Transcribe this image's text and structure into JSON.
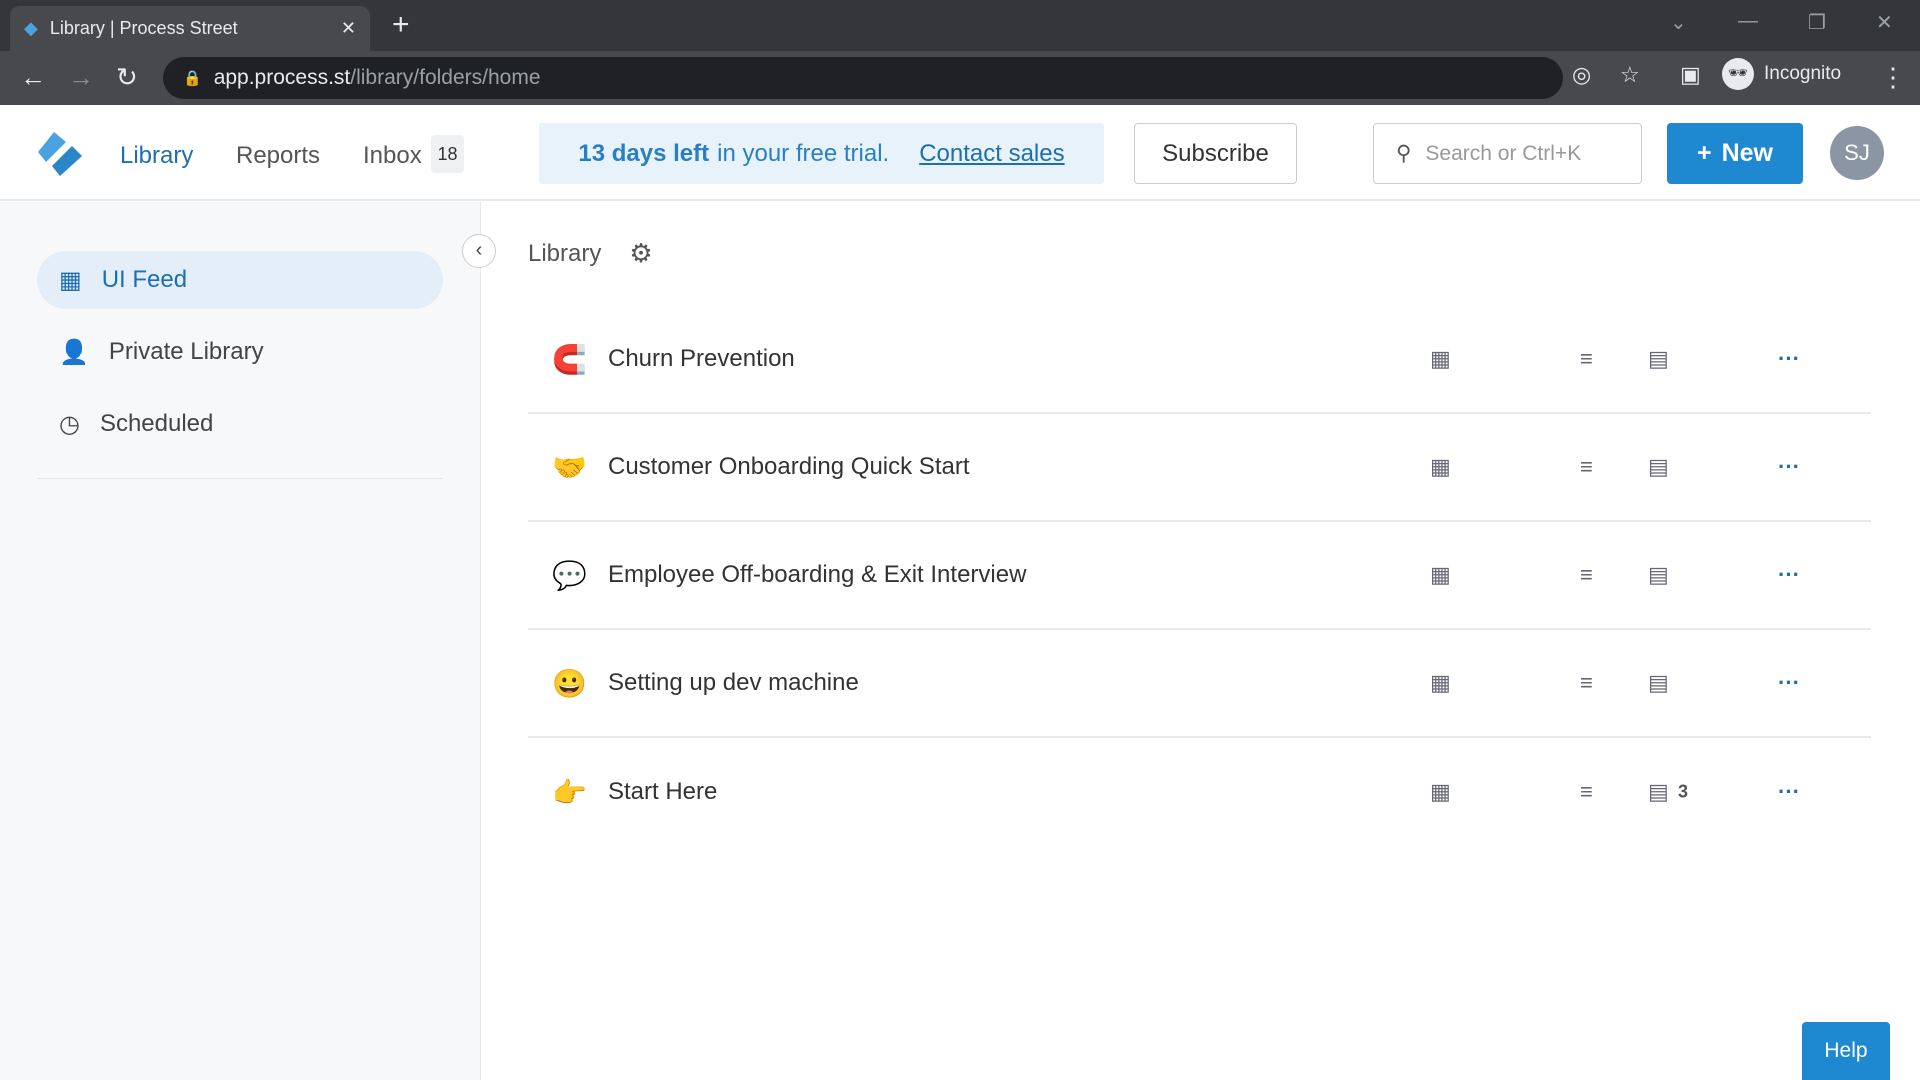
{
  "browser": {
    "tab_title": "Library | Process Street",
    "url_host": "app.process.st",
    "url_path": "/library/folders/home",
    "profile": "Incognito"
  },
  "header": {
    "nav": [
      {
        "label": "Library"
      },
      {
        "label": "Reports"
      },
      {
        "label": "Inbox"
      }
    ],
    "inbox_count": "18",
    "trial": {
      "bold": "13 days left",
      "rest": "in your free trial.",
      "link": "Contact sales"
    },
    "subscribe": "Subscribe",
    "search_placeholder": "Search or Ctrl+K",
    "new_label": "New",
    "avatar": "SJ"
  },
  "sidebar": {
    "items": [
      {
        "label": "UI Feed",
        "icon": "building-icon",
        "active": true
      },
      {
        "label": "Private Library",
        "icon": "user-lock-icon"
      },
      {
        "label": "Scheduled",
        "icon": "clock-icon"
      }
    ]
  },
  "breadcrumb": "Library",
  "rows": [
    {
      "title": "Churn Prevention",
      "emoji": "🧲",
      "count": ""
    },
    {
      "title": "Customer Onboarding Quick Start",
      "emoji": "🤝",
      "count": ""
    },
    {
      "title": "Employee Off-boarding & Exit Interview",
      "emoji": "💬",
      "count": ""
    },
    {
      "title": "Setting up dev machine",
      "emoji": "😀",
      "count": ""
    },
    {
      "title": "Start Here",
      "emoji": "👉",
      "count": "3"
    }
  ],
  "help": "Help",
  "colors": {
    "accent": "#1e88d0",
    "active_bg": "#e3eef8"
  }
}
